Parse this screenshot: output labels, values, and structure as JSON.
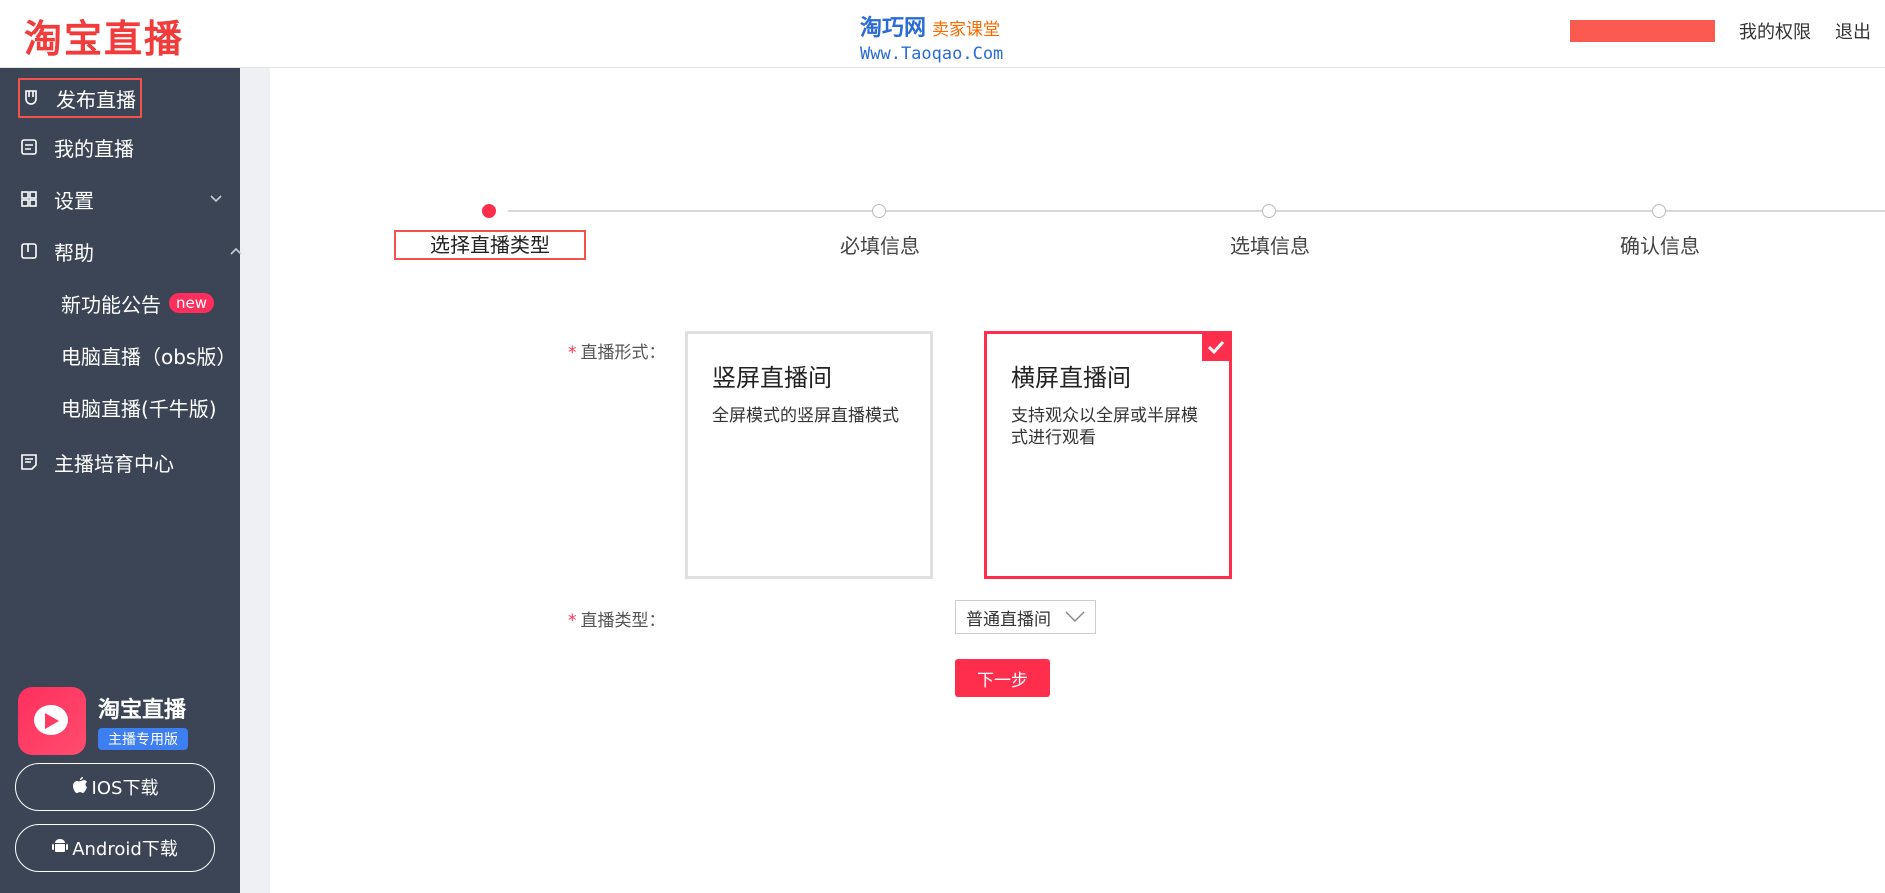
{
  "header": {
    "logo": "淘宝直播",
    "watermark_line1": "淘巧网",
    "watermark_sub": "卖家课堂",
    "watermark_line2": "Www.Taoqao.Com",
    "links": [
      "我的权限",
      "退出"
    ]
  },
  "sidebar": {
    "items": [
      {
        "label": "发布直播",
        "icon": "publish-icon"
      },
      {
        "label": "我的直播",
        "icon": "list-icon"
      },
      {
        "label": "设置",
        "icon": "grid-icon"
      },
      {
        "label": "帮助",
        "icon": "book-icon"
      },
      {
        "label": "主播培育中心",
        "icon": "note-icon"
      }
    ],
    "help_sub": [
      {
        "label": "新功能公告",
        "badge": "new"
      },
      {
        "label": "电脑直播（obs版）"
      },
      {
        "label": "电脑直播(千牛版)"
      }
    ],
    "app": {
      "title": "淘宝直播",
      "tag": "主播专用版"
    },
    "downloads": [
      "IOS下载",
      "Android下载"
    ]
  },
  "stepper": {
    "steps": [
      "选择直播类型",
      "必填信息",
      "选填信息",
      "确认信息"
    ],
    "active_index": 0
  },
  "form": {
    "format_label": "直播形式：",
    "options": [
      {
        "title": "竖屏直播间",
        "desc": "全屏模式的竖屏直播模式",
        "selected": false
      },
      {
        "title": "横屏直播间",
        "desc": "支持观众以全屏或半屏模式进行观看",
        "selected": true
      }
    ],
    "type_label": "直播类型：",
    "type_value": "普通直播间",
    "required_mark": "*",
    "next_label": "下一步"
  },
  "colors": {
    "accent": "#ff2e4d",
    "sidebar_bg": "#3b4555",
    "highlight": "#f2524a"
  }
}
